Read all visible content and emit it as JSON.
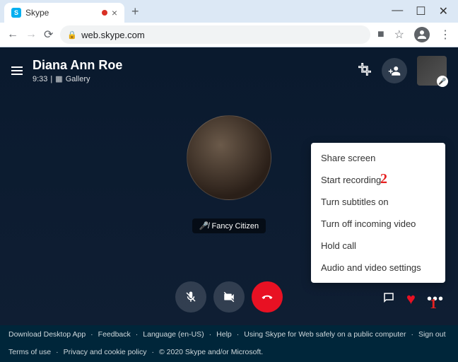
{
  "browser": {
    "tab_title": "Skype",
    "url": "web.skype.com"
  },
  "call": {
    "contact_name": "Diana Ann Roe",
    "duration": "9:33",
    "view_label": "Gallery",
    "self_name": "Fancy Citizen"
  },
  "menu": {
    "items": [
      "Share screen",
      "Start recording",
      "Turn subtitles on",
      "Turn off incoming video",
      "Hold call",
      "Audio and video settings"
    ]
  },
  "annotations": {
    "one": "1",
    "two": "2"
  },
  "footer": {
    "row1": [
      "Download Desktop App",
      "Feedback",
      "Language (en-US)",
      "Help",
      "Using Skype for Web safely on a public computer",
      "Sign out"
    ],
    "row2": [
      "Terms of use",
      "Privacy and cookie policy",
      "© 2020 Skype and/or Microsoft."
    ]
  }
}
